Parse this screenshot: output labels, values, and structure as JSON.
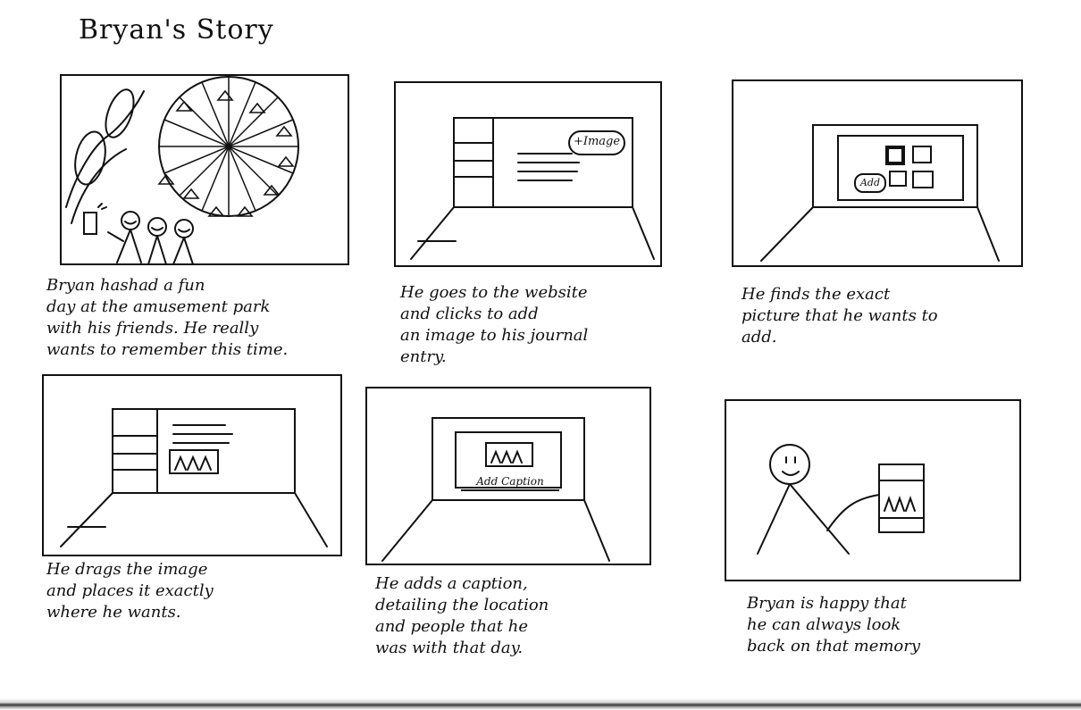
{
  "title": "Bryan's Story",
  "panels": [
    {
      "caption": "Bryan hashad a fun\nday at the amusement park\nwith his friends. He really\nwants to remember this time."
    },
    {
      "button_label": "+Image",
      "caption": "He goes to the website\nand clicks to add\nan image to his journal\nentry."
    },
    {
      "button_label": "Add",
      "caption": "He finds the exact\npicture that he wants to\nadd."
    },
    {
      "caption": "He drags the image\nand places it exactly\nwhere he wants."
    },
    {
      "button_label": "Add Caption",
      "caption": "He adds a caption,\ndetailing the location\nand people that he\nwas with that day."
    },
    {
      "caption": "Bryan is happy that\nhe can always look\nback on that memory"
    }
  ],
  "colors": {
    "ink": "#111111",
    "paper": "#ffffff"
  }
}
